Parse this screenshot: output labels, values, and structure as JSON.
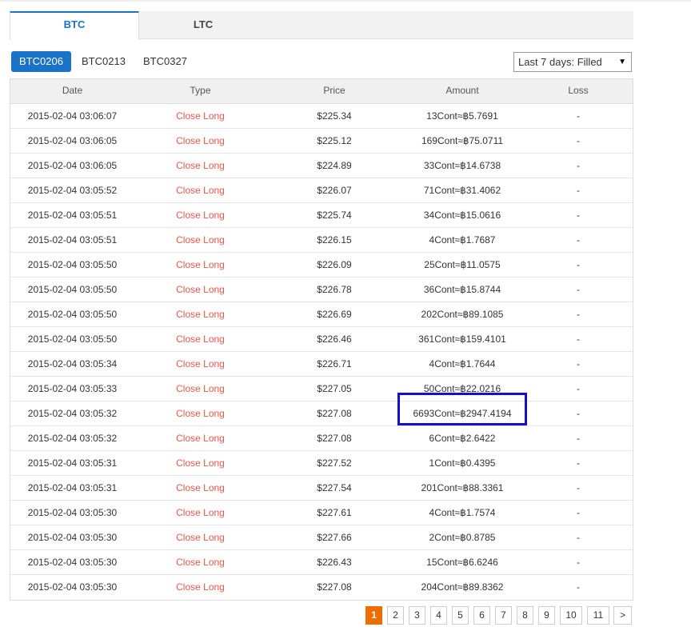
{
  "tabs": [
    {
      "label": "BTC",
      "active": true
    },
    {
      "label": "LTC",
      "active": false
    }
  ],
  "contracts": [
    {
      "label": "BTC0206",
      "active": true
    },
    {
      "label": "BTC0213",
      "active": false
    },
    {
      "label": "BTC0327",
      "active": false
    }
  ],
  "filter": {
    "selected": "Last 7 days: Filled",
    "caret": "▼"
  },
  "table": {
    "headers": {
      "date": "Date",
      "type": "Type",
      "price": "Price",
      "amount": "Amount",
      "loss": "Loss"
    },
    "rows": [
      {
        "date": "2015-02-04 03:06:07",
        "type": "Close Long",
        "price": "$225.34",
        "amount": "13Cont≈฿5.7691",
        "loss": "-"
      },
      {
        "date": "2015-02-04 03:06:05",
        "type": "Close Long",
        "price": "$225.12",
        "amount": "169Cont≈฿75.0711",
        "loss": "-"
      },
      {
        "date": "2015-02-04 03:06:05",
        "type": "Close Long",
        "price": "$224.89",
        "amount": "33Cont≈฿14.6738",
        "loss": "-"
      },
      {
        "date": "2015-02-04 03:05:52",
        "type": "Close Long",
        "price": "$226.07",
        "amount": "71Cont≈฿31.4062",
        "loss": "-"
      },
      {
        "date": "2015-02-04 03:05:51",
        "type": "Close Long",
        "price": "$225.74",
        "amount": "34Cont≈฿15.0616",
        "loss": "-"
      },
      {
        "date": "2015-02-04 03:05:51",
        "type": "Close Long",
        "price": "$226.15",
        "amount": "4Cont≈฿1.7687",
        "loss": "-"
      },
      {
        "date": "2015-02-04 03:05:50",
        "type": "Close Long",
        "price": "$226.09",
        "amount": "25Cont≈฿11.0575",
        "loss": "-"
      },
      {
        "date": "2015-02-04 03:05:50",
        "type": "Close Long",
        "price": "$226.78",
        "amount": "36Cont≈฿15.8744",
        "loss": "-"
      },
      {
        "date": "2015-02-04 03:05:50",
        "type": "Close Long",
        "price": "$226.69",
        "amount": "202Cont≈฿89.1085",
        "loss": "-"
      },
      {
        "date": "2015-02-04 03:05:50",
        "type": "Close Long",
        "price": "$226.46",
        "amount": "361Cont≈฿159.4101",
        "loss": "-"
      },
      {
        "date": "2015-02-04 03:05:34",
        "type": "Close Long",
        "price": "$226.71",
        "amount": "4Cont≈฿1.7644",
        "loss": "-"
      },
      {
        "date": "2015-02-04 03:05:33",
        "type": "Close Long",
        "price": "$227.05",
        "amount": "50Cont≈฿22.0216",
        "loss": "-"
      },
      {
        "date": "2015-02-04 03:05:32",
        "type": "Close Long",
        "price": "$227.08",
        "amount": "6693Cont≈฿2947.4194",
        "loss": "-"
      },
      {
        "date": "2015-02-04 03:05:32",
        "type": "Close Long",
        "price": "$227.08",
        "amount": "6Cont≈฿2.6422",
        "loss": "-"
      },
      {
        "date": "2015-02-04 03:05:31",
        "type": "Close Long",
        "price": "$227.52",
        "amount": "1Cont≈฿0.4395",
        "loss": "-"
      },
      {
        "date": "2015-02-04 03:05:31",
        "type": "Close Long",
        "price": "$227.54",
        "amount": "201Cont≈฿88.3361",
        "loss": "-"
      },
      {
        "date": "2015-02-04 03:05:30",
        "type": "Close Long",
        "price": "$227.61",
        "amount": "4Cont≈฿1.7574",
        "loss": "-"
      },
      {
        "date": "2015-02-04 03:05:30",
        "type": "Close Long",
        "price": "$227.66",
        "amount": "2Cont≈฿0.8785",
        "loss": "-"
      },
      {
        "date": "2015-02-04 03:05:30",
        "type": "Close Long",
        "price": "$226.43",
        "amount": "15Cont≈฿6.6246",
        "loss": "-"
      },
      {
        "date": "2015-02-04 03:05:30",
        "type": "Close Long",
        "price": "$227.08",
        "amount": "204Cont≈฿89.8362",
        "loss": "-"
      }
    ]
  },
  "pagination": {
    "pages": [
      "1",
      "2",
      "3",
      "4",
      "5",
      "6",
      "7",
      "8",
      "9",
      "10",
      "11"
    ],
    "current": "1",
    "next_label": ">"
  },
  "colors": {
    "accent": "#1a73c6",
    "close_long": "#e8584a",
    "page_active": "#ef6c00",
    "highlight": "#1212c8"
  }
}
